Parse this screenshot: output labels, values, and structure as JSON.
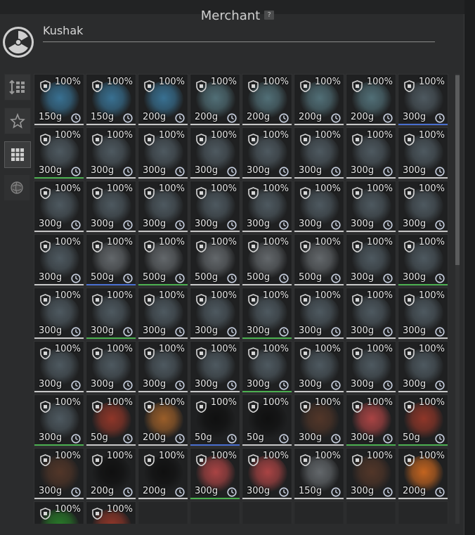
{
  "window": {
    "title": "Merchant",
    "help_label": "?"
  },
  "npc": {
    "name": "Kushak",
    "icon": "radiation-icon"
  },
  "sidebar": [
    {
      "name": "sort",
      "icon": "sort-icon",
      "active": false
    },
    {
      "name": "favorites",
      "icon": "star-icon",
      "active": false
    },
    {
      "name": "grid-view",
      "icon": "grid-icon",
      "active": true
    },
    {
      "name": "resources",
      "icon": "orb-icon",
      "active": false
    }
  ],
  "colors": {
    "blue": "#3d7fa6",
    "teal": "#5a7d86",
    "slate": "#56636b",
    "grey": "#6f7478",
    "red": "#a33a2a",
    "orange": "#b0692b",
    "black": "#0d0d0d",
    "brown": "#5b3a2a",
    "pink": "#c24a4a",
    "green": "#2a8a2a",
    "sun": "#e0701f",
    "rarity_common": "#c8c8c8",
    "rarity_uncommon": "#4caf50",
    "rarity_blue": "#4a6fd0"
  },
  "items": [
    {
      "durability": "100%",
      "price": "150g",
      "art": "blue",
      "rarity": "rarity_common"
    },
    {
      "durability": "100%",
      "price": "150g",
      "art": "blue",
      "rarity": "rarity_common"
    },
    {
      "durability": "100%",
      "price": "200g",
      "art": "blue",
      "rarity": "rarity_common"
    },
    {
      "durability": "100%",
      "price": "200g",
      "art": "teal",
      "rarity": "rarity_common"
    },
    {
      "durability": "100%",
      "price": "200g",
      "art": "teal",
      "rarity": "rarity_common"
    },
    {
      "durability": "100%",
      "price": "200g",
      "art": "teal",
      "rarity": "rarity_common"
    },
    {
      "durability": "100%",
      "price": "200g",
      "art": "teal",
      "rarity": "rarity_common"
    },
    {
      "durability": "100%",
      "price": "300g",
      "art": "slate",
      "rarity": "rarity_blue"
    },
    {
      "durability": "100%",
      "price": "300g",
      "art": "slate",
      "rarity": "rarity_uncommon"
    },
    {
      "durability": "100%",
      "price": "300g",
      "art": "slate",
      "rarity": "rarity_common"
    },
    {
      "durability": "100%",
      "price": "300g",
      "art": "slate",
      "rarity": "rarity_common"
    },
    {
      "durability": "100%",
      "price": "300g",
      "art": "slate",
      "rarity": "rarity_common"
    },
    {
      "durability": "100%",
      "price": "300g",
      "art": "slate",
      "rarity": "rarity_common"
    },
    {
      "durability": "100%",
      "price": "300g",
      "art": "slate",
      "rarity": "rarity_common"
    },
    {
      "durability": "100%",
      "price": "300g",
      "art": "slate",
      "rarity": "rarity_common"
    },
    {
      "durability": "100%",
      "price": "300g",
      "art": "slate",
      "rarity": "rarity_common"
    },
    {
      "durability": "100%",
      "price": "300g",
      "art": "slate",
      "rarity": "rarity_common"
    },
    {
      "durability": "100%",
      "price": "300g",
      "art": "slate",
      "rarity": "rarity_common"
    },
    {
      "durability": "100%",
      "price": "300g",
      "art": "slate",
      "rarity": "rarity_common"
    },
    {
      "durability": "100%",
      "price": "300g",
      "art": "slate",
      "rarity": "rarity_common"
    },
    {
      "durability": "100%",
      "price": "300g",
      "art": "slate",
      "rarity": "rarity_common"
    },
    {
      "durability": "100%",
      "price": "300g",
      "art": "slate",
      "rarity": "rarity_common"
    },
    {
      "durability": "100%",
      "price": "300g",
      "art": "slate",
      "rarity": "rarity_common"
    },
    {
      "durability": "100%",
      "price": "300g",
      "art": "slate",
      "rarity": "rarity_common"
    },
    {
      "durability": "100%",
      "price": "300g",
      "art": "slate",
      "rarity": "rarity_common"
    },
    {
      "durability": "100%",
      "price": "500g",
      "art": "grey",
      "rarity": "rarity_blue"
    },
    {
      "durability": "100%",
      "price": "500g",
      "art": "grey",
      "rarity": "rarity_uncommon"
    },
    {
      "durability": "100%",
      "price": "500g",
      "art": "grey",
      "rarity": "rarity_common"
    },
    {
      "durability": "100%",
      "price": "500g",
      "art": "grey",
      "rarity": "rarity_common"
    },
    {
      "durability": "100%",
      "price": "500g",
      "art": "grey",
      "rarity": "rarity_common"
    },
    {
      "durability": "100%",
      "price": "300g",
      "art": "slate",
      "rarity": "rarity_common"
    },
    {
      "durability": "100%",
      "price": "300g",
      "art": "slate",
      "rarity": "rarity_uncommon"
    },
    {
      "durability": "100%",
      "price": "300g",
      "art": "slate",
      "rarity": "rarity_common"
    },
    {
      "durability": "100%",
      "price": "300g",
      "art": "slate",
      "rarity": "rarity_uncommon"
    },
    {
      "durability": "100%",
      "price": "300g",
      "art": "slate",
      "rarity": "rarity_common"
    },
    {
      "durability": "100%",
      "price": "300g",
      "art": "slate",
      "rarity": "rarity_common"
    },
    {
      "durability": "100%",
      "price": "300g",
      "art": "slate",
      "rarity": "rarity_uncommon"
    },
    {
      "durability": "100%",
      "price": "300g",
      "art": "slate",
      "rarity": "rarity_common"
    },
    {
      "durability": "100%",
      "price": "300g",
      "art": "slate",
      "rarity": "rarity_common"
    },
    {
      "durability": "100%",
      "price": "300g",
      "art": "slate",
      "rarity": "rarity_common"
    },
    {
      "durability": "100%",
      "price": "300g",
      "art": "slate",
      "rarity": "rarity_common"
    },
    {
      "durability": "100%",
      "price": "300g",
      "art": "slate",
      "rarity": "rarity_common"
    },
    {
      "durability": "100%",
      "price": "300g",
      "art": "slate",
      "rarity": "rarity_common"
    },
    {
      "durability": "100%",
      "price": "300g",
      "art": "slate",
      "rarity": "rarity_common"
    },
    {
      "durability": "100%",
      "price": "300g",
      "art": "slate",
      "rarity": "rarity_uncommon"
    },
    {
      "durability": "100%",
      "price": "300g",
      "art": "slate",
      "rarity": "rarity_common"
    },
    {
      "durability": "100%",
      "price": "300g",
      "art": "slate",
      "rarity": "rarity_common"
    },
    {
      "durability": "100%",
      "price": "300g",
      "art": "slate",
      "rarity": "rarity_common"
    },
    {
      "durability": "100%",
      "price": "300g",
      "art": "slate",
      "rarity": "rarity_uncommon"
    },
    {
      "durability": "100%",
      "price": "50g",
      "art": "red",
      "rarity": "rarity_common"
    },
    {
      "durability": "100%",
      "price": "200g",
      "art": "orange",
      "rarity": "rarity_common"
    },
    {
      "durability": "100%",
      "price": "50g",
      "art": "black",
      "rarity": "rarity_blue"
    },
    {
      "durability": "100%",
      "price": "50g",
      "art": "black",
      "rarity": "rarity_common"
    },
    {
      "durability": "100%",
      "price": "300g",
      "art": "brown",
      "rarity": "rarity_common"
    },
    {
      "durability": "100%",
      "price": "300g",
      "art": "pink",
      "rarity": "rarity_uncommon"
    },
    {
      "durability": "100%",
      "price": "50g",
      "art": "red",
      "rarity": "rarity_uncommon"
    },
    {
      "durability": "100%",
      "price": "300g",
      "art": "brown",
      "rarity": "rarity_common"
    },
    {
      "durability": "100%",
      "price": "200g",
      "art": "black",
      "rarity": "rarity_common"
    },
    {
      "durability": "100%",
      "price": "200g",
      "art": "black",
      "rarity": "rarity_common"
    },
    {
      "durability": "100%",
      "price": "300g",
      "art": "pink",
      "rarity": "rarity_uncommon"
    },
    {
      "durability": "100%",
      "price": "300g",
      "art": "pink",
      "rarity": "rarity_common"
    },
    {
      "durability": "100%",
      "price": "150g",
      "art": "grey",
      "rarity": "rarity_common"
    },
    {
      "durability": "100%",
      "price": "300g",
      "art": "brown",
      "rarity": "rarity_common"
    },
    {
      "durability": "100%",
      "price": "200g",
      "art": "sun",
      "rarity": "rarity_common"
    },
    {
      "durability": "100%",
      "price": "",
      "art": "green",
      "rarity": ""
    },
    {
      "durability": "100%",
      "price": "",
      "art": "red",
      "rarity": ""
    },
    {
      "empty": true
    },
    {
      "empty": true
    },
    {
      "empty": true
    },
    {
      "empty": true
    },
    {
      "empty": true
    },
    {
      "empty": true
    }
  ]
}
